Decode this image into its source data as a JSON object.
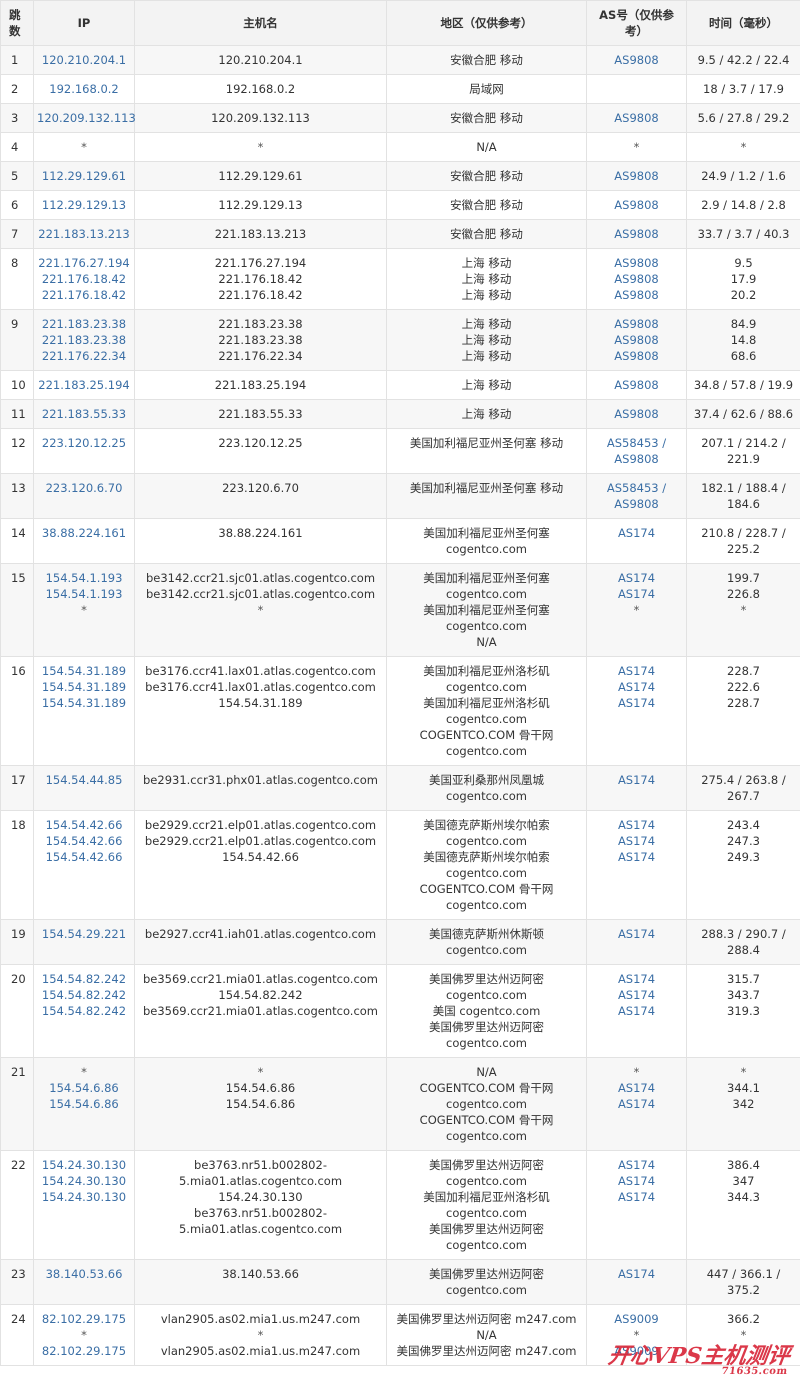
{
  "headers": {
    "hop": "跳数",
    "ip": "IP",
    "host": "主机名",
    "region": "地区（仅供参考）",
    "as": "AS号（仅供参考）",
    "time": "时间（毫秒）"
  },
  "rows": [
    {
      "hop": "1",
      "ip": [
        "120.210.204.1"
      ],
      "host": [
        "120.210.204.1"
      ],
      "region": [
        "安徽合肥 移动"
      ],
      "as": [
        "AS9808"
      ],
      "time": [
        "9.5 / 42.2 / 22.4"
      ]
    },
    {
      "hop": "2",
      "ip": [
        "192.168.0.2"
      ],
      "host": [
        "192.168.0.2"
      ],
      "region": [
        "局域网"
      ],
      "as": [],
      "time": [
        "18 / 3.7 / 17.9"
      ]
    },
    {
      "hop": "3",
      "ip": [
        "120.209.132.113"
      ],
      "host": [
        "120.209.132.113"
      ],
      "region": [
        "安徽合肥 移动"
      ],
      "as": [
        "AS9808"
      ],
      "time": [
        "5.6 / 27.8 / 29.2"
      ]
    },
    {
      "hop": "4",
      "ip": [
        "*"
      ],
      "host": [
        "*"
      ],
      "region": [
        "N/A"
      ],
      "as": [
        "*"
      ],
      "time": [
        "*"
      ]
    },
    {
      "hop": "5",
      "ip": [
        "112.29.129.61"
      ],
      "host": [
        "112.29.129.61"
      ],
      "region": [
        "安徽合肥 移动"
      ],
      "as": [
        "AS9808"
      ],
      "time": [
        "24.9 / 1.2 / 1.6"
      ]
    },
    {
      "hop": "6",
      "ip": [
        "112.29.129.13"
      ],
      "host": [
        "112.29.129.13"
      ],
      "region": [
        "安徽合肥 移动"
      ],
      "as": [
        "AS9808"
      ],
      "time": [
        "2.9 / 14.8 / 2.8"
      ]
    },
    {
      "hop": "7",
      "ip": [
        "221.183.13.213"
      ],
      "host": [
        "221.183.13.213"
      ],
      "region": [
        "安徽合肥 移动"
      ],
      "as": [
        "AS9808"
      ],
      "time": [
        "33.7 / 3.7 / 40.3"
      ]
    },
    {
      "hop": "8",
      "ip": [
        "221.176.27.194",
        "221.176.18.42",
        "221.176.18.42"
      ],
      "host": [
        "221.176.27.194",
        "221.176.18.42",
        "221.176.18.42"
      ],
      "region": [
        "上海 移动",
        "上海 移动",
        "上海 移动"
      ],
      "as": [
        "AS9808",
        "AS9808",
        "AS9808"
      ],
      "time": [
        "9.5",
        "17.9",
        "20.2"
      ]
    },
    {
      "hop": "9",
      "ip": [
        "221.183.23.38",
        "221.183.23.38",
        "221.176.22.34"
      ],
      "host": [
        "221.183.23.38",
        "221.183.23.38",
        "221.176.22.34"
      ],
      "region": [
        "上海 移动",
        "上海 移动",
        "上海 移动"
      ],
      "as": [
        "AS9808",
        "AS9808",
        "AS9808"
      ],
      "time": [
        "84.9",
        "14.8",
        "68.6"
      ]
    },
    {
      "hop": "10",
      "ip": [
        "221.183.25.194"
      ],
      "host": [
        "221.183.25.194"
      ],
      "region": [
        "上海 移动"
      ],
      "as": [
        "AS9808"
      ],
      "time": [
        "34.8 / 57.8 / 19.9"
      ]
    },
    {
      "hop": "11",
      "ip": [
        "221.183.55.33"
      ],
      "host": [
        "221.183.55.33"
      ],
      "region": [
        "上海 移动"
      ],
      "as": [
        "AS9808"
      ],
      "time": [
        "37.4 / 62.6 / 88.6"
      ]
    },
    {
      "hop": "12",
      "ip": [
        "223.120.12.25"
      ],
      "host": [
        "223.120.12.25"
      ],
      "region": [
        "美国加利福尼亚州圣何塞 移动"
      ],
      "as": [
        "AS58453 /",
        "AS9808"
      ],
      "time": [
        "207.1 / 214.2 /",
        "221.9"
      ]
    },
    {
      "hop": "13",
      "ip": [
        "223.120.6.70"
      ],
      "host": [
        "223.120.6.70"
      ],
      "region": [
        "美国加利福尼亚州圣何塞 移动"
      ],
      "as": [
        "AS58453 /",
        "AS9808"
      ],
      "time": [
        "182.1 / 188.4 /",
        "184.6"
      ]
    },
    {
      "hop": "14",
      "ip": [
        "38.88.224.161"
      ],
      "host": [
        "38.88.224.161"
      ],
      "region": [
        "美国加利福尼亚州圣何塞",
        "cogentco.com"
      ],
      "as": [
        "AS174"
      ],
      "time": [
        "210.8 / 228.7 /",
        "225.2"
      ]
    },
    {
      "hop": "15",
      "ip": [
        "154.54.1.193",
        "154.54.1.193",
        "*"
      ],
      "host": [
        "be3142.ccr21.sjc01.atlas.cogentco.com",
        "be3142.ccr21.sjc01.atlas.cogentco.com",
        "*"
      ],
      "region": [
        "美国加利福尼亚州圣何塞",
        "cogentco.com",
        "美国加利福尼亚州圣何塞",
        "cogentco.com",
        "N/A"
      ],
      "as": [
        "AS174",
        "AS174",
        "*"
      ],
      "time": [
        "199.7",
        "226.8",
        "*"
      ]
    },
    {
      "hop": "16",
      "ip": [
        "154.54.31.189",
        "154.54.31.189",
        "154.54.31.189"
      ],
      "host": [
        "be3176.ccr41.lax01.atlas.cogentco.com",
        "be3176.ccr41.lax01.atlas.cogentco.com",
        "154.54.31.189"
      ],
      "region": [
        "美国加利福尼亚州洛杉矶",
        "cogentco.com",
        "美国加利福尼亚州洛杉矶",
        "cogentco.com",
        "COGENTCO.COM 骨干网",
        "cogentco.com"
      ],
      "as": [
        "AS174",
        "AS174",
        "AS174"
      ],
      "time": [
        "228.7",
        "222.6",
        "228.7"
      ]
    },
    {
      "hop": "17",
      "ip": [
        "154.54.44.85"
      ],
      "host": [
        "be2931.ccr31.phx01.atlas.cogentco.com"
      ],
      "region": [
        "美国亚利桑那州凤凰城",
        "cogentco.com"
      ],
      "as": [
        "AS174"
      ],
      "time": [
        "275.4 / 263.8 /",
        "267.7"
      ]
    },
    {
      "hop": "18",
      "ip": [
        "154.54.42.66",
        "154.54.42.66",
        "154.54.42.66"
      ],
      "host": [
        "be2929.ccr21.elp01.atlas.cogentco.com",
        "be2929.ccr21.elp01.atlas.cogentco.com",
        "154.54.42.66"
      ],
      "region": [
        "美国德克萨斯州埃尔帕索",
        "cogentco.com",
        "美国德克萨斯州埃尔帕索",
        "cogentco.com",
        "COGENTCO.COM 骨干网",
        "cogentco.com"
      ],
      "as": [
        "AS174",
        "AS174",
        "AS174"
      ],
      "time": [
        "243.4",
        "247.3",
        "249.3"
      ]
    },
    {
      "hop": "19",
      "ip": [
        "154.54.29.221"
      ],
      "host": [
        "be2927.ccr41.iah01.atlas.cogentco.com"
      ],
      "region": [
        "美国德克萨斯州休斯顿",
        "cogentco.com"
      ],
      "as": [
        "AS174"
      ],
      "time": [
        "288.3 / 290.7 /",
        "288.4"
      ]
    },
    {
      "hop": "20",
      "ip": [
        "154.54.82.242",
        "154.54.82.242",
        "154.54.82.242"
      ],
      "host": [
        "be3569.ccr21.mia01.atlas.cogentco.com",
        "154.54.82.242",
        "be3569.ccr21.mia01.atlas.cogentco.com"
      ],
      "region": [
        "美国佛罗里达州迈阿密",
        "cogentco.com",
        "美国 cogentco.com",
        "美国佛罗里达州迈阿密",
        "cogentco.com"
      ],
      "as": [
        "AS174",
        "AS174",
        "AS174"
      ],
      "time": [
        "315.7",
        "343.7",
        "319.3"
      ]
    },
    {
      "hop": "21",
      "ip": [
        "*",
        "154.54.6.86",
        "154.54.6.86"
      ],
      "host": [
        "*",
        "154.54.6.86",
        "154.54.6.86"
      ],
      "region": [
        "N/A",
        "COGENTCO.COM 骨干网",
        "cogentco.com",
        "COGENTCO.COM 骨干网",
        "cogentco.com"
      ],
      "as": [
        "*",
        "AS174",
        "AS174"
      ],
      "time": [
        "*",
        "344.1",
        "342"
      ]
    },
    {
      "hop": "22",
      "ip": [
        "154.24.30.130",
        "154.24.30.130",
        "154.24.30.130"
      ],
      "host": [
        "be3763.nr51.b002802-",
        "5.mia01.atlas.cogentco.com",
        "154.24.30.130",
        "be3763.nr51.b002802-",
        "5.mia01.atlas.cogentco.com"
      ],
      "region": [
        "美国佛罗里达州迈阿密",
        "cogentco.com",
        "美国加利福尼亚州洛杉矶",
        "cogentco.com",
        "美国佛罗里达州迈阿密",
        "cogentco.com"
      ],
      "as": [
        "AS174",
        "AS174",
        "AS174"
      ],
      "time": [
        "386.4",
        "347",
        "344.3"
      ]
    },
    {
      "hop": "23",
      "ip": [
        "38.140.53.66"
      ],
      "host": [
        "38.140.53.66"
      ],
      "region": [
        "美国佛罗里达州迈阿密",
        "cogentco.com"
      ],
      "as": [
        "AS174"
      ],
      "time": [
        "447 / 366.1 /",
        "375.2"
      ]
    },
    {
      "hop": "24",
      "ip": [
        "82.102.29.175",
        "*",
        "82.102.29.175"
      ],
      "host": [
        "vlan2905.as02.mia1.us.m247.com",
        "*",
        "vlan2905.as02.mia1.us.m247.com"
      ],
      "region": [
        "美国佛罗里达州迈阿密 m247.com",
        "N/A",
        "美国佛罗里达州迈阿密 m247.com"
      ],
      "as": [
        "AS9009",
        "*",
        "AS9009"
      ],
      "time": [
        "366.2",
        "*",
        ""
      ]
    }
  ],
  "watermark": {
    "text": "开心VPS主机测评",
    "sub": "71635.com"
  }
}
